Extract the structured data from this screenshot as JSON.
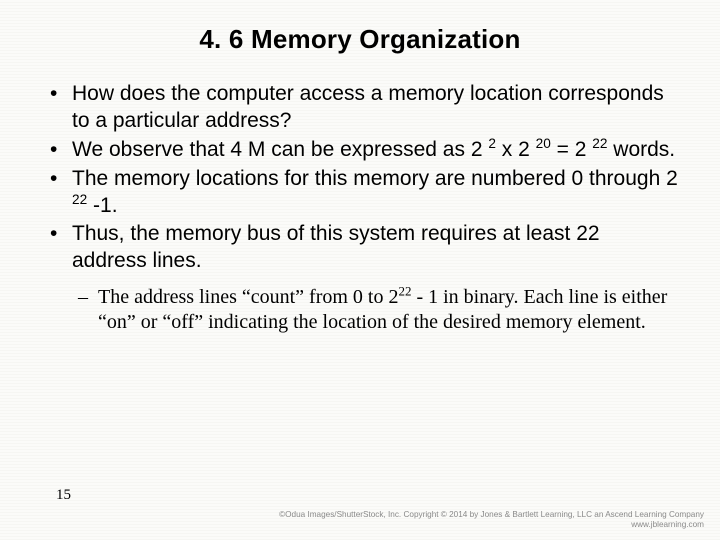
{
  "title": "4. 6 Memory Organization",
  "bullets": {
    "b1": "How does the computer access a memory location corresponds to a particular address?",
    "b2_pre": "We observe that 4 M can be expressed as 2 ",
    "b2_sup1": "2",
    "b2_mid": " x 2 ",
    "b2_sup2": "20",
    "b2_eq": " = 2 ",
    "b2_sup3": "22",
    "b2_post": " words.",
    "b3_pre": "The memory locations for this memory are numbered 0 through 2 ",
    "b3_sup": "22",
    "b3_post": " -1.",
    "b4": "Thus, the memory bus of this system requires at least 22 address lines."
  },
  "sub": {
    "s1_pre": "The address lines “count” from 0 to 2",
    "s1_sup": "22",
    "s1_post": " - 1 in binary. Each line is either “on” or “off” indicating the location of the desired memory element."
  },
  "page_number": "15",
  "copyright_line1": "©Odua Images/ShutterStock, Inc. Copyright © 2014 by Jones & Bartlett Learning, LLC an Ascend Learning Company",
  "copyright_line2": "www.jblearning.com"
}
